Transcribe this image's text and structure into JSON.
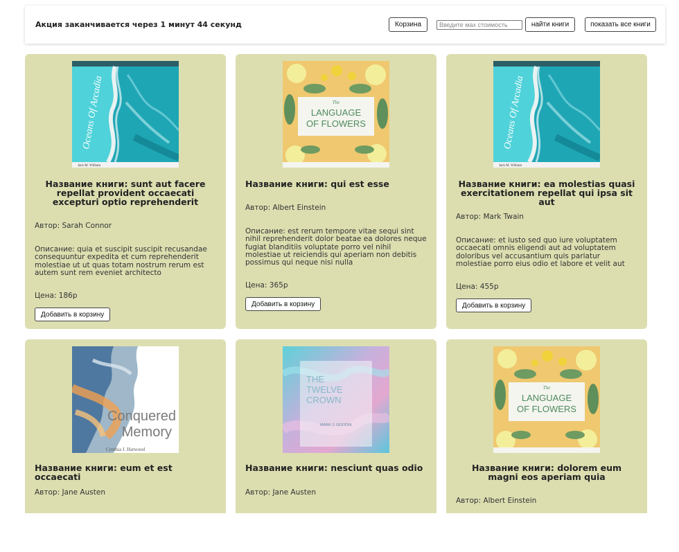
{
  "header": {
    "promo_text": "Акция заканчивается через 1 минут 44 секунд",
    "cart_label": "Корзина",
    "price_placeholder": "Введите мах стоимость",
    "find_label": "найти книги",
    "show_all_label": "показать все книги"
  },
  "cards": [
    {
      "title": "Название книги: sunt aut facere repellat provident occaecati excepturi optio reprehenderit",
      "author": "Автор: Sarah Connor",
      "description": "Описание: quia et suscipit suscipit recusandae consequuntur expedita et cum reprehenderit molestiae ut ut quas totam nostrum rerum est autem sunt rem eveniet architecto",
      "price": "Цена: 186р",
      "add_label": "Добавить в корзину",
      "cover": {
        "kind": "ocean",
        "title": "Oceans Of Arcadia",
        "author": "Jack M. William"
      }
    },
    {
      "title": "Название книги: qui est esse",
      "author": "Автор: Albert Einstein",
      "description": "Описание: est rerum tempore vitae sequi sint nihil reprehenderit dolor beatae ea dolores neque fugiat blanditiis voluptate porro vel nihil molestiae ut reiciendis qui aperiam non debitis possimus qui neque nisi nulla",
      "price": "Цена: 365р",
      "add_label": "Добавить в корзину",
      "cover": {
        "kind": "flowers",
        "small": "The",
        "title_1": "LANGUAGE",
        "title_2": "OF FLOWERS"
      }
    },
    {
      "title": "Название книги: ea molestias quasi exercitationem repellat qui ipsa sit aut",
      "author": "Автор: Mark Twain",
      "description": "Описание: et iusto sed quo iure voluptatem occaecati omnis eligendi aut ad voluptatem doloribus vel accusantium quis pariatur molestiae porro eius odio et labore et velit aut",
      "price": "Цена: 455р",
      "add_label": "Добавить в корзину",
      "cover": {
        "kind": "ocean",
        "title": "Oceans Of Arcadia",
        "author": "Jack M. William"
      }
    },
    {
      "title": "Название книги: eum et est occaecati",
      "author": "Автор: Jane Austen",
      "cover": {
        "kind": "memory",
        "title_1": "Conquered",
        "title_2": "Memory",
        "author": "Cynthia J. Harwood"
      }
    },
    {
      "title": "Название книги: nesciunt quas odio",
      "author": "Автор: Jane Austen",
      "cover": {
        "kind": "crown",
        "title_1": "THE",
        "title_2": "TWELVE",
        "title_3": "CROWN",
        "author": "MARK J. GOODIN"
      }
    },
    {
      "title": "Название книги: dolorem eum magni eos aperiam quia",
      "author": "Автор: Albert Einstein",
      "cover": {
        "kind": "flowers",
        "small": "The",
        "title_1": "LANGUAGE",
        "title_2": "OF FLOWERS"
      }
    }
  ]
}
